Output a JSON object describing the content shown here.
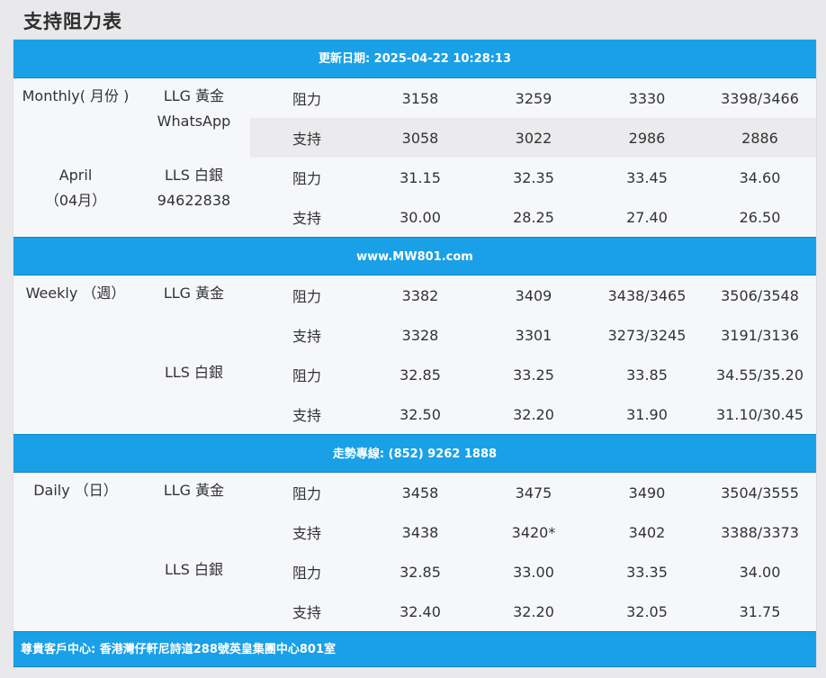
{
  "page_title": "支持阻力表",
  "update_bar": "更新日期: 2025-04-22 10:28:13",
  "site_bar": "www.MW801.com",
  "hotline_bar": "走勢專線: (852) 9262 1888",
  "footer_bar": "尊貴客戶中心: 香港灣仔軒尼詩道288號英皇集團中心801室",
  "monthly": {
    "period_lines": [
      "Monthly( 月份 )",
      "",
      "",
      "April",
      "（04月）"
    ],
    "gold_lines": [
      "LLG 黃金",
      "WhatsApp"
    ],
    "silver_lines": [
      "LLS 白銀",
      "94622838"
    ],
    "rows": [
      {
        "label": "阻力",
        "values": [
          "3158",
          "3259",
          "3330",
          "3398/3466"
        ]
      },
      {
        "label": "支持",
        "values": [
          "3058",
          "3022",
          "2986",
          "2886"
        ]
      },
      {
        "label": "阻力",
        "values": [
          "31.15",
          "32.35",
          "33.45",
          "34.60"
        ]
      },
      {
        "label": "支持",
        "values": [
          "30.00",
          "28.25",
          "27.40",
          "26.50"
        ]
      }
    ]
  },
  "weekly": {
    "period": "Weekly （週）",
    "gold": "LLG 黃金",
    "silver": "LLS 白銀",
    "rows": [
      {
        "label": "阻力",
        "values": [
          "3382",
          "3409",
          "3438/3465",
          "3506/3548"
        ]
      },
      {
        "label": "支持",
        "values": [
          "3328",
          "3301",
          "3273/3245",
          "3191/3136"
        ]
      },
      {
        "label": "阻力",
        "values": [
          "32.85",
          "33.25",
          "33.85",
          "34.55/35.20"
        ]
      },
      {
        "label": "支持",
        "values": [
          "32.50",
          "32.20",
          "31.90",
          "31.10/30.45"
        ]
      }
    ]
  },
  "daily": {
    "period": "Daily （日）",
    "gold": "LLG 黃金",
    "silver": "LLS 白銀",
    "rows": [
      {
        "label": "阻力",
        "values": [
          "3458",
          "3475",
          "3490",
          "3504/3555"
        ]
      },
      {
        "label": "支持",
        "values": [
          "3438",
          "3420*",
          "3402",
          "3388/3373"
        ]
      },
      {
        "label": "阻力",
        "values": [
          "32.85",
          "33.00",
          "33.35",
          "34.00"
        ]
      },
      {
        "label": "支持",
        "values": [
          "32.40",
          "32.20",
          "32.05",
          "31.75"
        ]
      }
    ]
  }
}
